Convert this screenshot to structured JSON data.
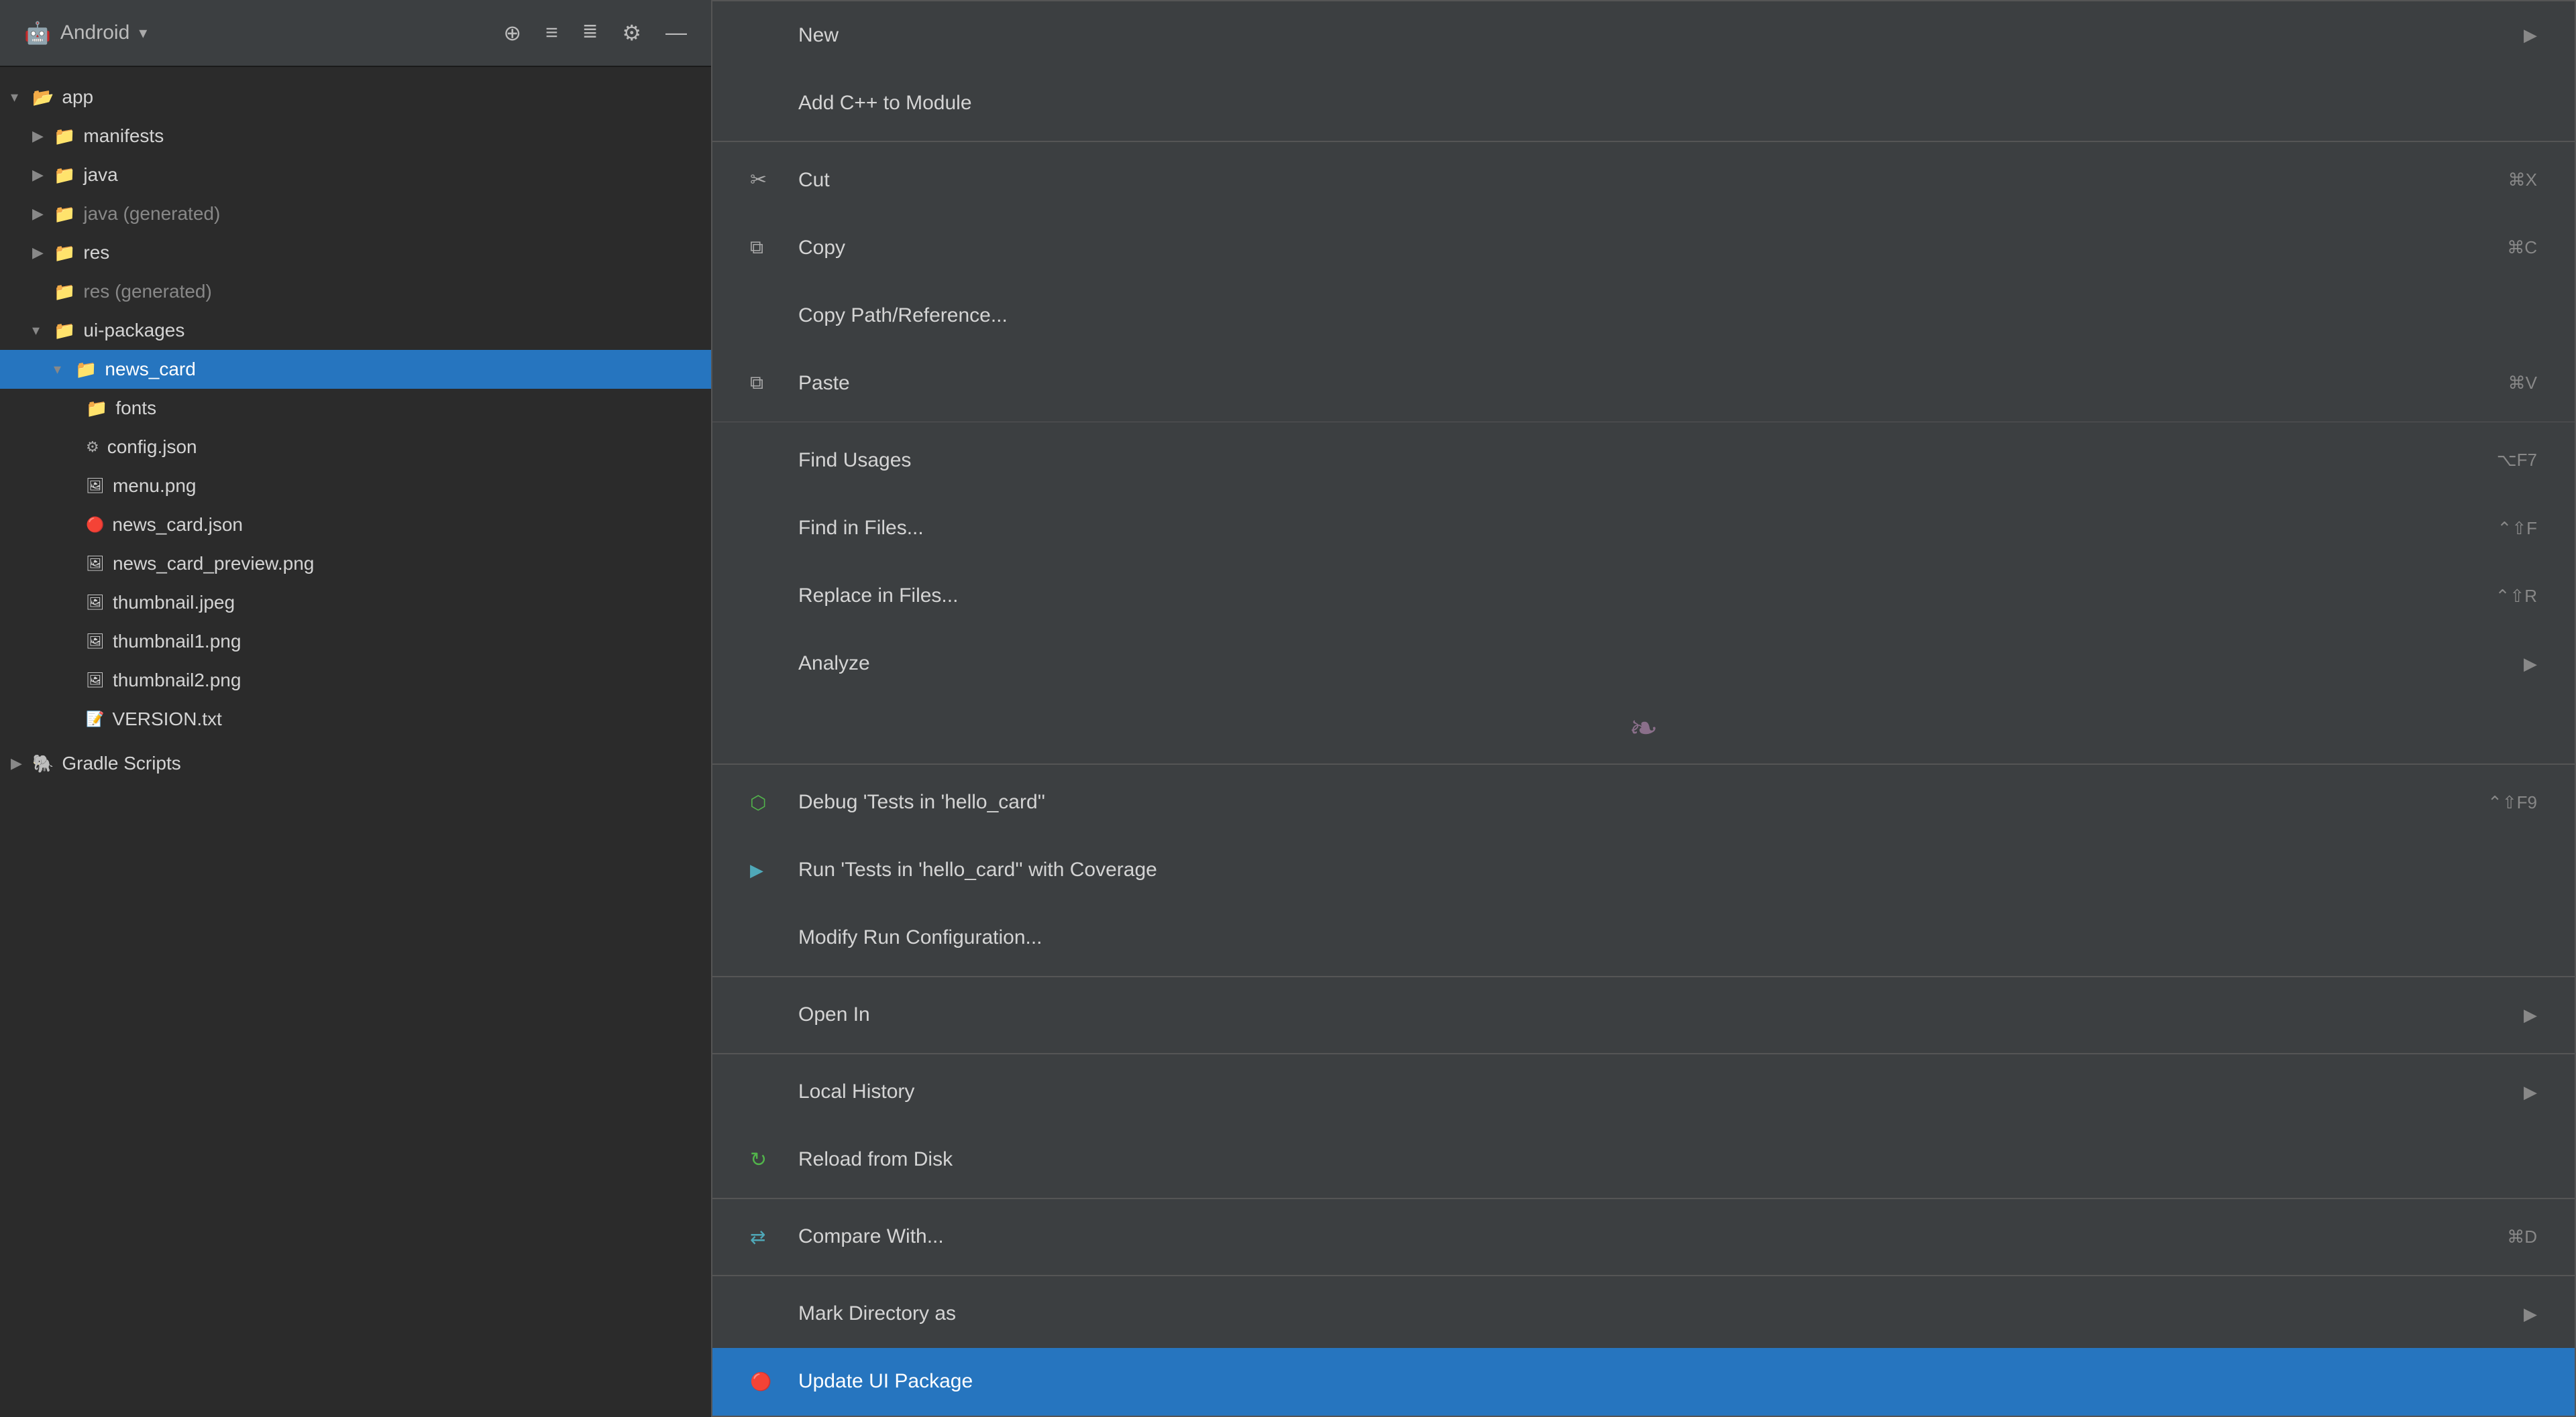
{
  "toolbar": {
    "project_label": "Android",
    "icons": [
      "⊕",
      "≡",
      "≡↓",
      "⚙",
      "—"
    ]
  },
  "filetree": {
    "items": [
      {
        "id": "app",
        "label": "app",
        "type": "folder-open",
        "level": 0,
        "expanded": true,
        "icon_color": "green"
      },
      {
        "id": "manifests",
        "label": "manifests",
        "type": "folder",
        "level": 1,
        "expanded": false,
        "icon_color": "blue"
      },
      {
        "id": "java",
        "label": "java",
        "type": "folder",
        "level": 1,
        "expanded": false,
        "icon_color": "blue"
      },
      {
        "id": "java-gen",
        "label": "java (generated)",
        "type": "folder",
        "level": 1,
        "expanded": false,
        "icon_color": "blue",
        "generated": true
      },
      {
        "id": "res",
        "label": "res",
        "type": "folder",
        "level": 1,
        "expanded": false,
        "icon_color": "blue"
      },
      {
        "id": "res-gen",
        "label": "res (generated)",
        "type": "folder-leaf",
        "level": 1,
        "expanded": false,
        "icon_color": "blue",
        "generated": true
      },
      {
        "id": "ui-packages",
        "label": "ui-packages",
        "type": "folder",
        "level": 1,
        "expanded": true,
        "icon_color": "blue"
      },
      {
        "id": "news_card",
        "label": "news_card",
        "type": "folder-open",
        "level": 2,
        "expanded": true,
        "icon_color": "blue",
        "selected": true
      },
      {
        "id": "fonts",
        "label": "fonts",
        "type": "folder-leaf",
        "level": 3,
        "icon_color": "blue"
      },
      {
        "id": "config.json",
        "label": "config.json",
        "type": "json",
        "level": 3
      },
      {
        "id": "menu.png",
        "label": "menu.png",
        "type": "png",
        "level": 3
      },
      {
        "id": "news_card.json",
        "label": "news_card.json",
        "type": "json-red",
        "level": 3
      },
      {
        "id": "news_card_prev.png",
        "label": "news_card_preview.png",
        "type": "png",
        "level": 3
      },
      {
        "id": "thumbnail.jpeg",
        "label": "thumbnail.jpeg",
        "type": "png",
        "level": 3
      },
      {
        "id": "thumbnail1.png",
        "label": "thumbnail1.png",
        "type": "png",
        "level": 3
      },
      {
        "id": "thumbnail2.png",
        "label": "thumbnail2.png",
        "type": "png",
        "level": 3
      },
      {
        "id": "VERSION.txt",
        "label": "VERSION.txt",
        "type": "txt",
        "level": 3
      },
      {
        "id": "gradle-scripts",
        "label": "Gradle Scripts",
        "type": "gradle",
        "level": 0,
        "expanded": false
      }
    ]
  },
  "context_menu": {
    "items": [
      {
        "id": "new",
        "label": "New",
        "shortcut": "",
        "has_arrow": true,
        "icon": "▤",
        "separator_before": false,
        "highlighted": false
      },
      {
        "id": "add-cpp",
        "label": "Add C++ to Module",
        "shortcut": "",
        "has_arrow": false,
        "icon": "",
        "separator_before": false,
        "highlighted": false
      },
      {
        "id": "cut",
        "label": "Cut",
        "shortcut": "⌘X",
        "has_arrow": false,
        "icon": "✂",
        "separator_before": true,
        "highlighted": false
      },
      {
        "id": "copy",
        "label": "Copy",
        "shortcut": "⌘C",
        "has_arrow": false,
        "icon": "⧉",
        "separator_before": false,
        "highlighted": false
      },
      {
        "id": "copy-path",
        "label": "Copy Path/Reference...",
        "shortcut": "",
        "has_arrow": false,
        "icon": "",
        "separator_before": false,
        "highlighted": false
      },
      {
        "id": "paste",
        "label": "Paste",
        "shortcut": "⌘V",
        "has_arrow": false,
        "icon": "⧉",
        "separator_before": false,
        "highlighted": false
      },
      {
        "id": "find-usages",
        "label": "Find Usages",
        "shortcut": "⌥F7",
        "has_arrow": false,
        "icon": "",
        "separator_before": true,
        "highlighted": false
      },
      {
        "id": "find-in-files",
        "label": "Find in Files...",
        "shortcut": "⌃⇧F",
        "has_arrow": false,
        "icon": "",
        "separator_before": false,
        "highlighted": false
      },
      {
        "id": "replace-in-files",
        "label": "Replace in Files...",
        "shortcut": "⌃⇧R",
        "has_arrow": false,
        "icon": "",
        "separator_before": false,
        "highlighted": false
      },
      {
        "id": "analyze",
        "label": "Analyze",
        "shortcut": "",
        "has_arrow": true,
        "icon": "",
        "separator_before": false,
        "highlighted": false
      },
      {
        "id": "spinner",
        "label": "",
        "type": "spinner",
        "shortcut": "",
        "has_arrow": false,
        "icon": ""
      },
      {
        "id": "debug",
        "label": "Debug 'Tests in 'hello_card''",
        "shortcut": "⌃⇧F9",
        "has_arrow": false,
        "icon": "🐞",
        "separator_before": false,
        "highlighted": false
      },
      {
        "id": "run-coverage",
        "label": "Run 'Tests in 'hello_card'' with Coverage",
        "shortcut": "",
        "has_arrow": false,
        "icon": "▶",
        "separator_before": false,
        "highlighted": false
      },
      {
        "id": "modify-run",
        "label": "Modify Run Configuration...",
        "shortcut": "",
        "has_arrow": false,
        "icon": "",
        "separator_before": false,
        "highlighted": false
      },
      {
        "id": "open-in",
        "label": "Open In",
        "shortcut": "",
        "has_arrow": true,
        "icon": "",
        "separator_before": true,
        "highlighted": false
      },
      {
        "id": "local-history",
        "label": "Local History",
        "shortcut": "",
        "has_arrow": true,
        "icon": "",
        "separator_before": true,
        "highlighted": false
      },
      {
        "id": "reload-from-disk",
        "label": "Reload from Disk",
        "shortcut": "",
        "has_arrow": false,
        "icon": "↻",
        "separator_before": false,
        "highlighted": false
      },
      {
        "id": "compare-with",
        "label": "Compare With...",
        "shortcut": "⌘D",
        "has_arrow": false,
        "icon": "⇄",
        "separator_before": true,
        "highlighted": false
      },
      {
        "id": "mark-directory-as",
        "label": "Mark Directory as",
        "shortcut": "",
        "has_arrow": true,
        "icon": "",
        "separator_before": true,
        "highlighted": false
      },
      {
        "id": "update-ui-package",
        "label": "Update UI Package",
        "shortcut": "",
        "has_arrow": false,
        "icon": "🔴",
        "separator_before": false,
        "highlighted": true
      }
    ]
  }
}
